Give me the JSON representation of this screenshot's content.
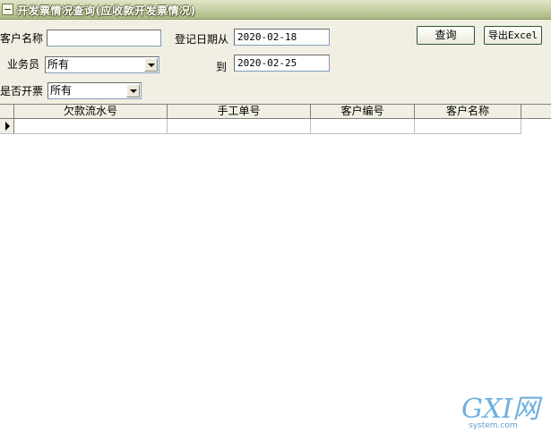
{
  "window": {
    "title": "开发票情况查询(应收款开发票情况)"
  },
  "filters": {
    "customer_name": {
      "label": "客户名称",
      "value": ""
    },
    "register_date_from": {
      "label": "登记日期从",
      "value": "2020-02-18"
    },
    "register_date_to": {
      "label": "到",
      "value": "2020-02-25"
    },
    "salesperson": {
      "label": "业务员",
      "selected": "所有"
    },
    "invoiced": {
      "label": "是否开票",
      "selected": "所有"
    }
  },
  "buttons": {
    "query": "查询",
    "export": "导出Excel"
  },
  "grid": {
    "columns": [
      "欠款流水号",
      "手工单号",
      "客户编号",
      "客户名称"
    ],
    "rows": []
  },
  "watermark": {
    "main": "GXI网",
    "sub": "system.com"
  },
  "colors": {
    "titlebar": "#c3cda0",
    "panel": "#f1efe3",
    "watermark": "#6db0e0"
  }
}
